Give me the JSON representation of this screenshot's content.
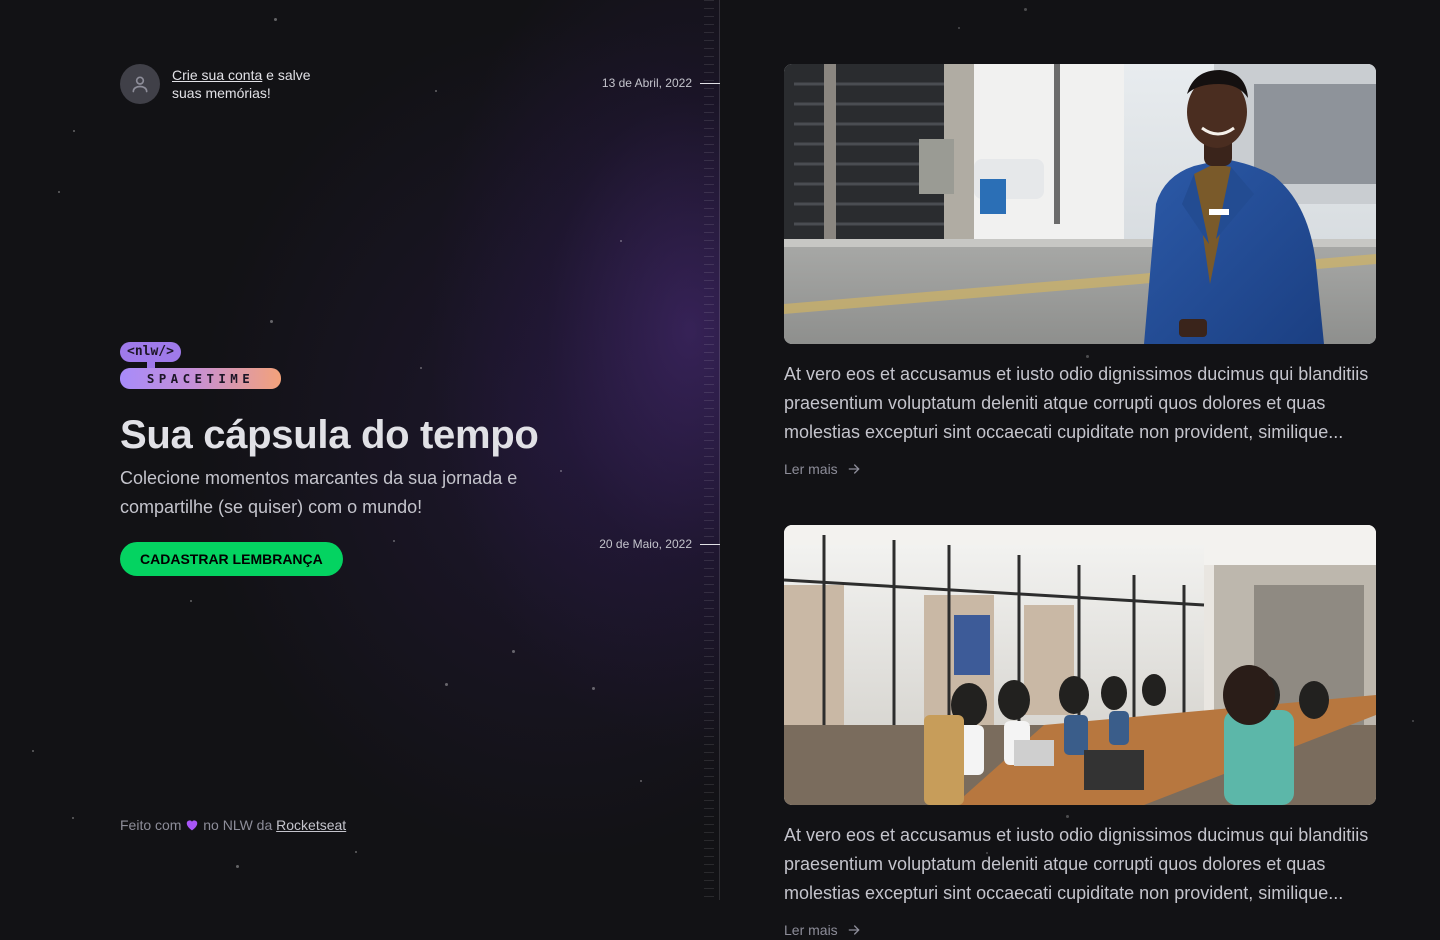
{
  "signin": {
    "link_text": "Crie sua conta",
    "rest_text": " e salve suas memórias!"
  },
  "timeline": {
    "dates": [
      "13 de Abril, 2022",
      "20 de Maio, 2022"
    ]
  },
  "logo": {
    "top": "<nlw/>",
    "bottom": "SPACETIME"
  },
  "hero": {
    "title": "Sua cápsula do tempo",
    "subtitle": "Colecione momentos marcantes da sua jornada e compartilhe (se quiser) com o mundo!",
    "cta_label": "CADASTRAR LEMBRANÇA"
  },
  "footer": {
    "prefix": "Feito com",
    "heart_icon": "purple-heart-icon",
    "middle": " no NLW da ",
    "link_text": "Rocketseat"
  },
  "memories": [
    {
      "image_alt": "businessman-blue-suit-street-photo",
      "excerpt": "At vero eos et accusamus et iusto odio dignissimos ducimus qui blanditiis praesentium voluptatum deleniti atque corrupti quos dolores et quas molestias excepturi sint occaecati cupiditate non provident, similique...",
      "read_more": "Ler mais"
    },
    {
      "image_alt": "team-meeting-conference-room-photo",
      "excerpt": "At vero eos et accusamus et iusto odio dignissimos ducimus qui blanditiis praesentium voluptatum deleniti atque corrupti quos dolores et quas molestias excepturi sint occaecati cupiditate non provident, similique...",
      "read_more": "Ler mais"
    }
  ],
  "colors": {
    "background": "#121215",
    "accent_green": "#04d361",
    "accent_purple": "#9f7aea",
    "text": "#e1e1e6",
    "muted": "#8d8d99"
  }
}
